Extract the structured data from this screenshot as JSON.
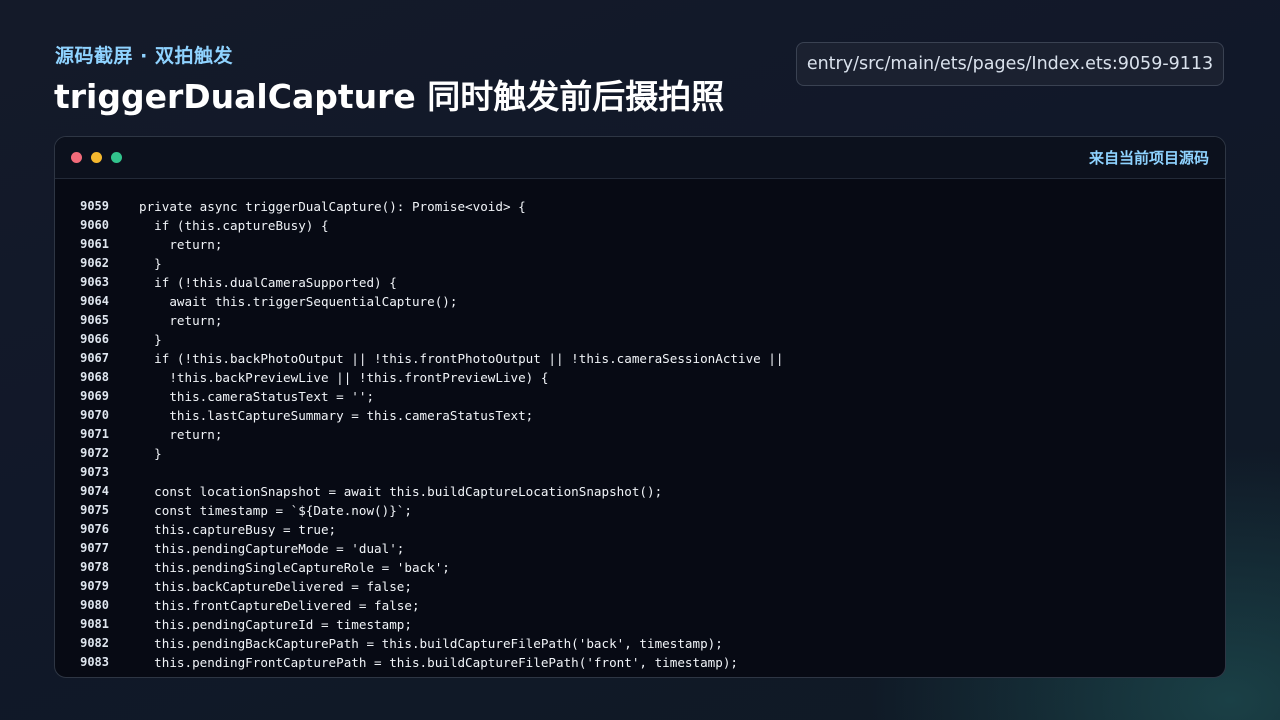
{
  "header": {
    "kicker": "源码截屏 · 双拍触发",
    "title": "triggerDualCapture 同时触发前后摄拍照",
    "path": "entry/src/main/ets/pages/Index.ets:9059-9113"
  },
  "window": {
    "label": "来自当前项目源码",
    "dot_colors": [
      "#f26b7a",
      "#f5b82e",
      "#32c48d"
    ]
  },
  "code": {
    "lines": [
      {
        "n": "9059",
        "t": "private async triggerDualCapture(): Promise<void> {"
      },
      {
        "n": "9060",
        "t": "  if (this.captureBusy) {"
      },
      {
        "n": "9061",
        "t": "    return;"
      },
      {
        "n": "9062",
        "t": "  }"
      },
      {
        "n": "9063",
        "t": "  if (!this.dualCameraSupported) {"
      },
      {
        "n": "9064",
        "t": "    await this.triggerSequentialCapture();"
      },
      {
        "n": "9065",
        "t": "    return;"
      },
      {
        "n": "9066",
        "t": "  }"
      },
      {
        "n": "9067",
        "t": "  if (!this.backPhotoOutput || !this.frontPhotoOutput || !this.cameraSessionActive ||"
      },
      {
        "n": "9068",
        "t": "    !this.backPreviewLive || !this.frontPreviewLive) {"
      },
      {
        "n": "9069",
        "t": "    this.cameraStatusText = '';"
      },
      {
        "n": "9070",
        "t": "    this.lastCaptureSummary = this.cameraStatusText;"
      },
      {
        "n": "9071",
        "t": "    return;"
      },
      {
        "n": "9072",
        "t": "  }"
      },
      {
        "n": "9073",
        "t": ""
      },
      {
        "n": "9074",
        "t": "  const locationSnapshot = await this.buildCaptureLocationSnapshot();"
      },
      {
        "n": "9075",
        "t": "  const timestamp = `${Date.now()}`;"
      },
      {
        "n": "9076",
        "t": "  this.captureBusy = true;"
      },
      {
        "n": "9077",
        "t": "  this.pendingCaptureMode = 'dual';"
      },
      {
        "n": "9078",
        "t": "  this.pendingSingleCaptureRole = 'back';"
      },
      {
        "n": "9079",
        "t": "  this.backCaptureDelivered = false;"
      },
      {
        "n": "9080",
        "t": "  this.frontCaptureDelivered = false;"
      },
      {
        "n": "9081",
        "t": "  this.pendingCaptureId = timestamp;"
      },
      {
        "n": "9082",
        "t": "  this.pendingBackCapturePath = this.buildCaptureFilePath('back', timestamp);"
      },
      {
        "n": "9083",
        "t": "  this.pendingFrontCapturePath = this.buildCaptureFilePath('front', timestamp);"
      }
    ]
  }
}
